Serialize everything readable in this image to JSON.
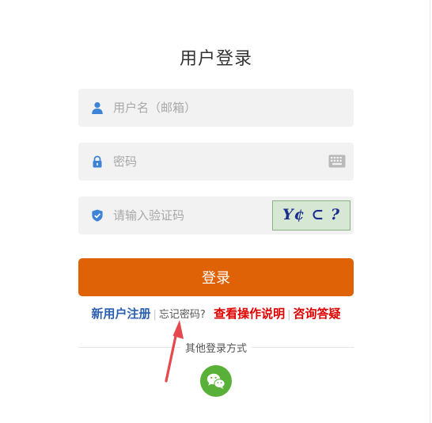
{
  "login": {
    "title": "用户登录",
    "username_placeholder": "用户名（邮箱）",
    "password_placeholder": "密码",
    "captcha_placeholder": "请输入验证码",
    "captcha_text": "Y¢ ⊂ ?",
    "submit_label": "登录"
  },
  "links": {
    "register": "新用户注册",
    "forgot": "忘记密码?",
    "guide": "查看操作说明",
    "help": "咨询答疑",
    "separator": "|"
  },
  "other": {
    "label": "其他登录方式"
  },
  "colors": {
    "accent": "#e06206",
    "icon_blue": "#3d84d6",
    "register_blue": "#2a5fb0",
    "red_link": "#e00000",
    "wechat_green": "#59b038",
    "annotation_arrow": "#e5484d"
  },
  "icons": {
    "username": "user-icon",
    "password": "lock-icon",
    "captcha": "shield-check-icon",
    "keyboard": "keyboard-icon",
    "wechat": "wechat-icon",
    "annotation": "arrow-annotation-icon"
  }
}
